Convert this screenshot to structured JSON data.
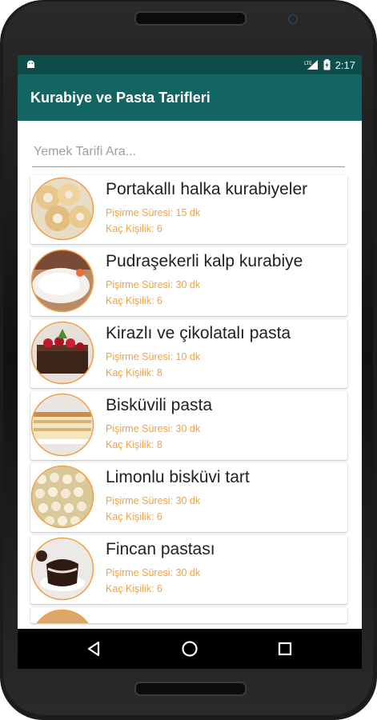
{
  "status": {
    "time": "2:17",
    "network": "LTE"
  },
  "app": {
    "title": "Kurabiye ve Pasta Tarifleri"
  },
  "search": {
    "placeholder": "Yemek Tarifi Ara..."
  },
  "recipes": [
    {
      "name": "Portakallı halka kurabiyeler",
      "time": "Pişirme Süresi: 15 dk",
      "servings": "Kaç Kişilik: 6"
    },
    {
      "name": "Pudraşekerli kalp kurabiye",
      "time": "Pişirme Süresi: 30 dk",
      "servings": "Kaç Kişilik: 6"
    },
    {
      "name": "Kirazlı ve çikolatalı pasta",
      "time": "Pişirme Süresi: 10 dk",
      "servings": "Kaç Kişilik: 8"
    },
    {
      "name": "Bisküvili pasta",
      "time": "Pişirme Süresi: 30 dk",
      "servings": "Kaç Kişilik: 8"
    },
    {
      "name": "Limonlu bisküvi tart",
      "time": "Pişirme Süresi: 30 dk",
      "servings": "Kaç Kişilik: 6"
    },
    {
      "name": "Fincan pastası",
      "time": "Pişirme Süresi: 30 dk",
      "servings": "Kaç Kişilik: 6"
    }
  ],
  "colors": {
    "primary": "#136563",
    "primary_dark": "#0c4d4a",
    "accent": "#f4a13a",
    "thumb_border": "#f0a04b"
  },
  "icons": {
    "status_left": "android-icon",
    "status_right": [
      "signal-icon",
      "battery-icon"
    ],
    "navigation": [
      "back-icon",
      "home-icon",
      "recents-icon"
    ]
  }
}
